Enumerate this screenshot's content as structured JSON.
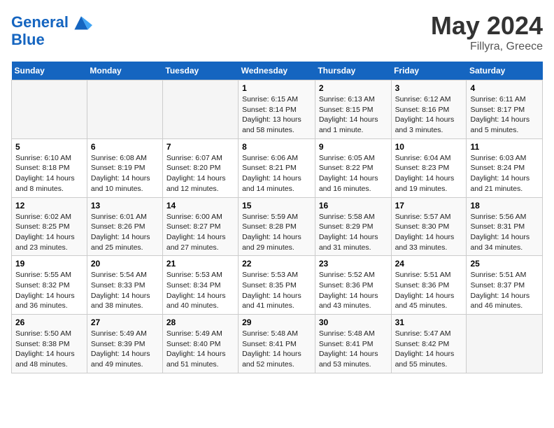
{
  "header": {
    "logo_line1": "General",
    "logo_line2": "Blue",
    "month": "May 2024",
    "location": "Fillyra, Greece"
  },
  "weekdays": [
    "Sunday",
    "Monday",
    "Tuesday",
    "Wednesday",
    "Thursday",
    "Friday",
    "Saturday"
  ],
  "weeks": [
    [
      {
        "day": "",
        "info": ""
      },
      {
        "day": "",
        "info": ""
      },
      {
        "day": "",
        "info": ""
      },
      {
        "day": "1",
        "info": "Sunrise: 6:15 AM\nSunset: 8:14 PM\nDaylight: 13 hours and 58 minutes."
      },
      {
        "day": "2",
        "info": "Sunrise: 6:13 AM\nSunset: 8:15 PM\nDaylight: 14 hours and 1 minute."
      },
      {
        "day": "3",
        "info": "Sunrise: 6:12 AM\nSunset: 8:16 PM\nDaylight: 14 hours and 3 minutes."
      },
      {
        "day": "4",
        "info": "Sunrise: 6:11 AM\nSunset: 8:17 PM\nDaylight: 14 hours and 5 minutes."
      }
    ],
    [
      {
        "day": "5",
        "info": "Sunrise: 6:10 AM\nSunset: 8:18 PM\nDaylight: 14 hours and 8 minutes."
      },
      {
        "day": "6",
        "info": "Sunrise: 6:08 AM\nSunset: 8:19 PM\nDaylight: 14 hours and 10 minutes."
      },
      {
        "day": "7",
        "info": "Sunrise: 6:07 AM\nSunset: 8:20 PM\nDaylight: 14 hours and 12 minutes."
      },
      {
        "day": "8",
        "info": "Sunrise: 6:06 AM\nSunset: 8:21 PM\nDaylight: 14 hours and 14 minutes."
      },
      {
        "day": "9",
        "info": "Sunrise: 6:05 AM\nSunset: 8:22 PM\nDaylight: 14 hours and 16 minutes."
      },
      {
        "day": "10",
        "info": "Sunrise: 6:04 AM\nSunset: 8:23 PM\nDaylight: 14 hours and 19 minutes."
      },
      {
        "day": "11",
        "info": "Sunrise: 6:03 AM\nSunset: 8:24 PM\nDaylight: 14 hours and 21 minutes."
      }
    ],
    [
      {
        "day": "12",
        "info": "Sunrise: 6:02 AM\nSunset: 8:25 PM\nDaylight: 14 hours and 23 minutes."
      },
      {
        "day": "13",
        "info": "Sunrise: 6:01 AM\nSunset: 8:26 PM\nDaylight: 14 hours and 25 minutes."
      },
      {
        "day": "14",
        "info": "Sunrise: 6:00 AM\nSunset: 8:27 PM\nDaylight: 14 hours and 27 minutes."
      },
      {
        "day": "15",
        "info": "Sunrise: 5:59 AM\nSunset: 8:28 PM\nDaylight: 14 hours and 29 minutes."
      },
      {
        "day": "16",
        "info": "Sunrise: 5:58 AM\nSunset: 8:29 PM\nDaylight: 14 hours and 31 minutes."
      },
      {
        "day": "17",
        "info": "Sunrise: 5:57 AM\nSunset: 8:30 PM\nDaylight: 14 hours and 33 minutes."
      },
      {
        "day": "18",
        "info": "Sunrise: 5:56 AM\nSunset: 8:31 PM\nDaylight: 14 hours and 34 minutes."
      }
    ],
    [
      {
        "day": "19",
        "info": "Sunrise: 5:55 AM\nSunset: 8:32 PM\nDaylight: 14 hours and 36 minutes."
      },
      {
        "day": "20",
        "info": "Sunrise: 5:54 AM\nSunset: 8:33 PM\nDaylight: 14 hours and 38 minutes."
      },
      {
        "day": "21",
        "info": "Sunrise: 5:53 AM\nSunset: 8:34 PM\nDaylight: 14 hours and 40 minutes."
      },
      {
        "day": "22",
        "info": "Sunrise: 5:53 AM\nSunset: 8:35 PM\nDaylight: 14 hours and 41 minutes."
      },
      {
        "day": "23",
        "info": "Sunrise: 5:52 AM\nSunset: 8:36 PM\nDaylight: 14 hours and 43 minutes."
      },
      {
        "day": "24",
        "info": "Sunrise: 5:51 AM\nSunset: 8:36 PM\nDaylight: 14 hours and 45 minutes."
      },
      {
        "day": "25",
        "info": "Sunrise: 5:51 AM\nSunset: 8:37 PM\nDaylight: 14 hours and 46 minutes."
      }
    ],
    [
      {
        "day": "26",
        "info": "Sunrise: 5:50 AM\nSunset: 8:38 PM\nDaylight: 14 hours and 48 minutes."
      },
      {
        "day": "27",
        "info": "Sunrise: 5:49 AM\nSunset: 8:39 PM\nDaylight: 14 hours and 49 minutes."
      },
      {
        "day": "28",
        "info": "Sunrise: 5:49 AM\nSunset: 8:40 PM\nDaylight: 14 hours and 51 minutes."
      },
      {
        "day": "29",
        "info": "Sunrise: 5:48 AM\nSunset: 8:41 PM\nDaylight: 14 hours and 52 minutes."
      },
      {
        "day": "30",
        "info": "Sunrise: 5:48 AM\nSunset: 8:41 PM\nDaylight: 14 hours and 53 minutes."
      },
      {
        "day": "31",
        "info": "Sunrise: 5:47 AM\nSunset: 8:42 PM\nDaylight: 14 hours and 55 minutes."
      },
      {
        "day": "",
        "info": ""
      }
    ]
  ]
}
